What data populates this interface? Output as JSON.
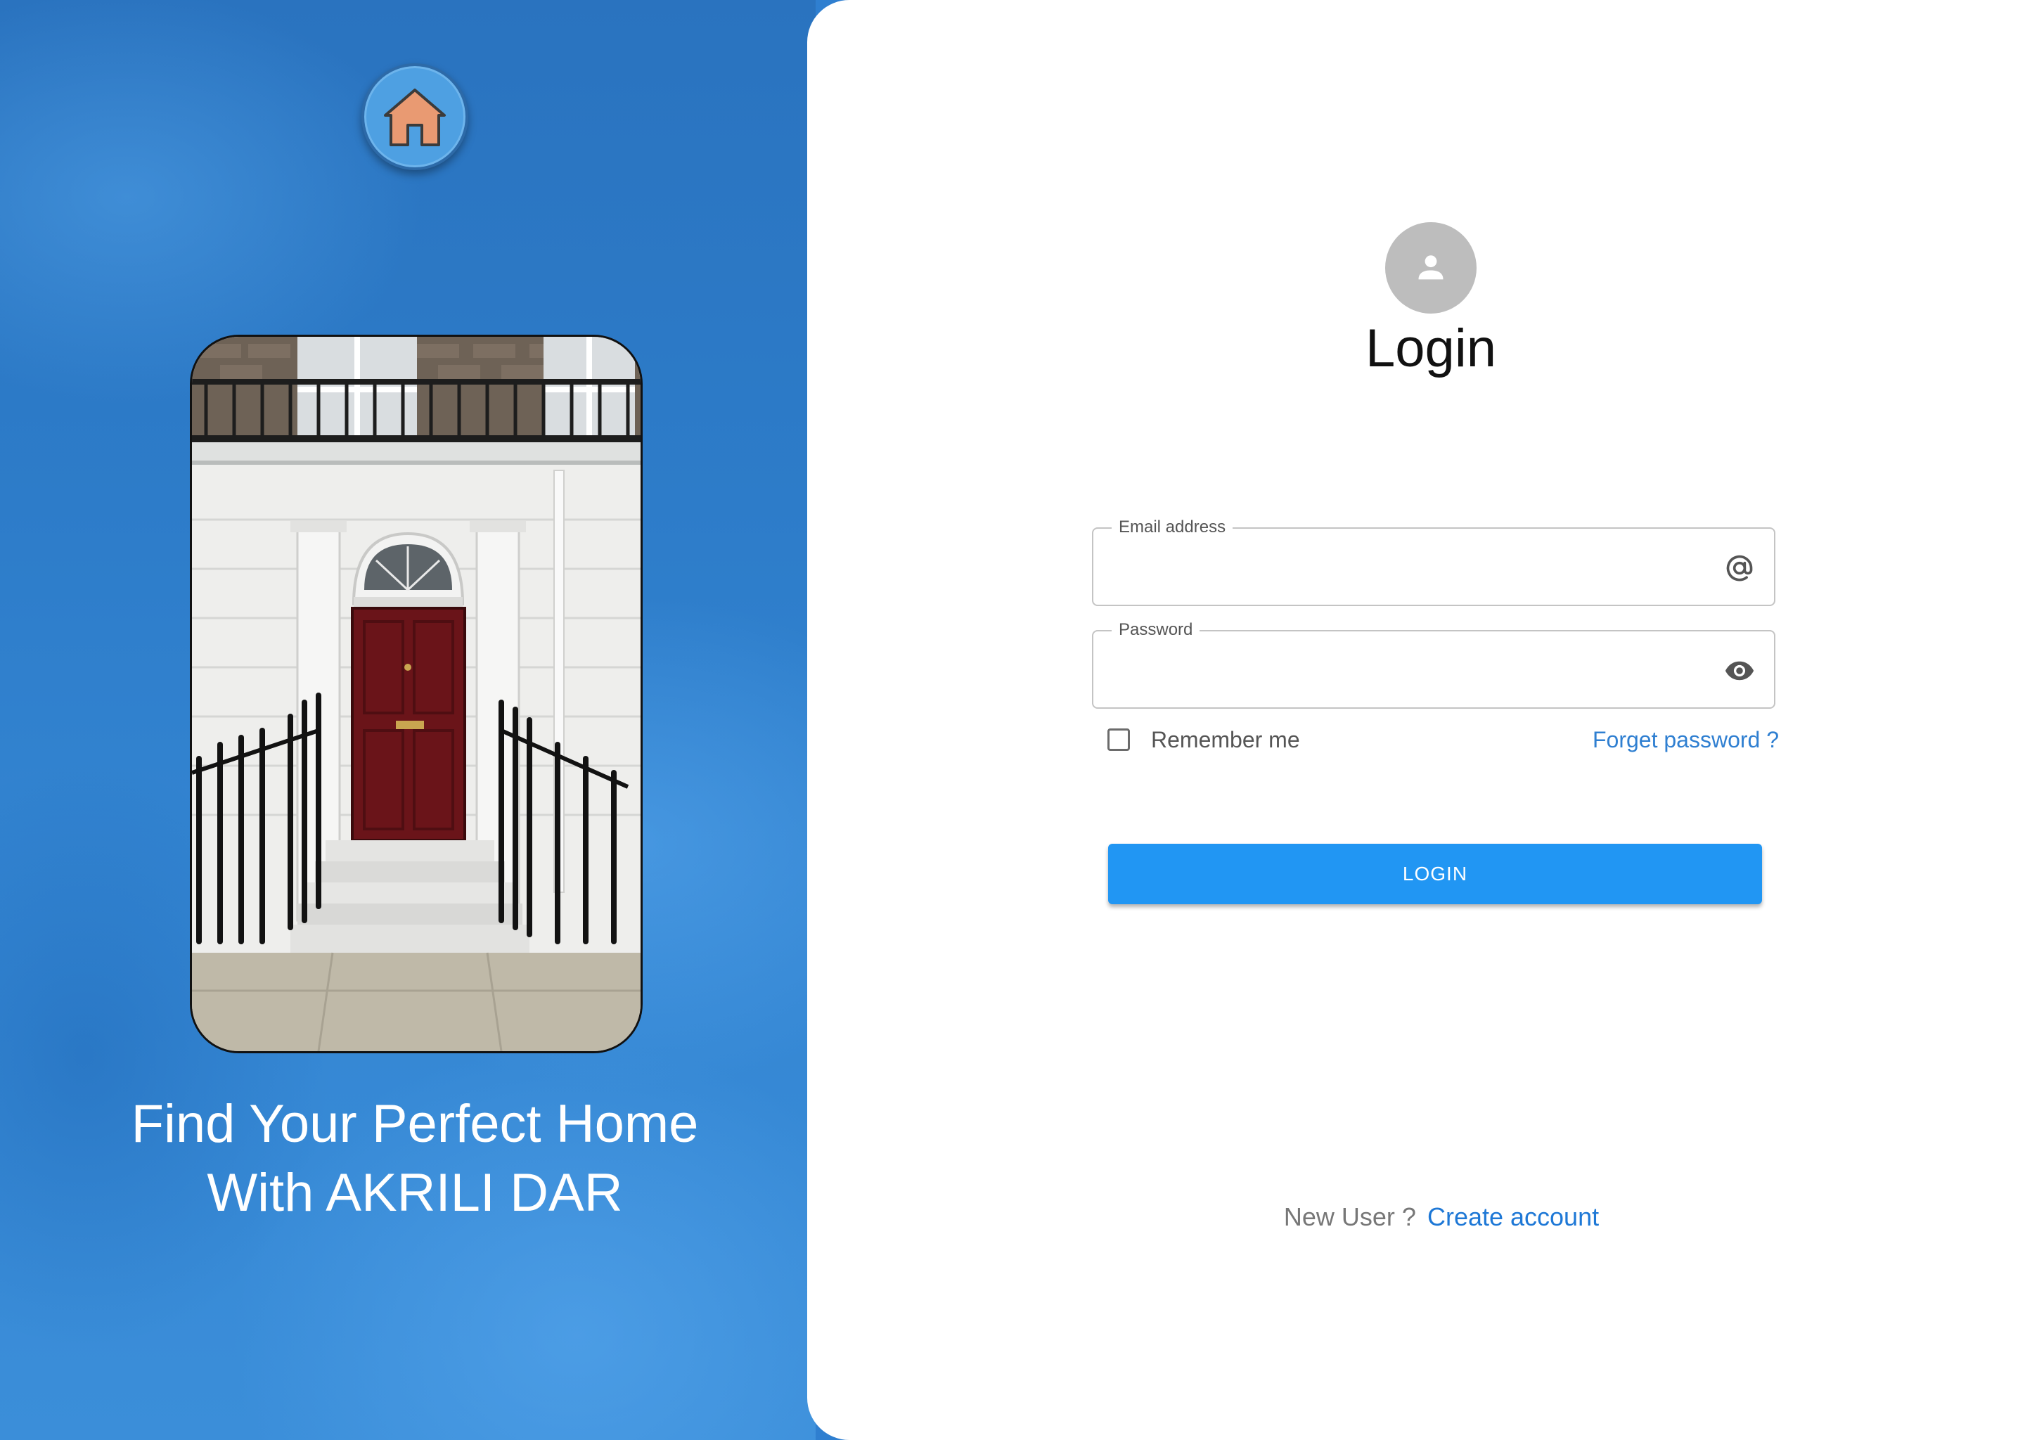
{
  "brand": {
    "logo_icon": "house-icon",
    "tagline_line1": "Find Your Perfect Home",
    "tagline_line2": "With AKRILI DAR",
    "photo_icon": "front-door-photo"
  },
  "login": {
    "avatar_icon": "person-icon",
    "title": "Login",
    "email": {
      "label": "Email address",
      "value": "",
      "icon": "at-sign-icon"
    },
    "password": {
      "label": "Password",
      "value": "",
      "icon": "eye-icon"
    },
    "remember_label": "Remember me",
    "remember_checked": false,
    "forgot_label": "Forget password ?",
    "submit_label": "LOGIN",
    "new_user_text": "New User ?",
    "create_account_label": "Create account"
  },
  "colors": {
    "left_background": "#2f7fd0",
    "button": "#2196f3",
    "link": "#1e78d6",
    "logo_house": "#e99a72"
  }
}
